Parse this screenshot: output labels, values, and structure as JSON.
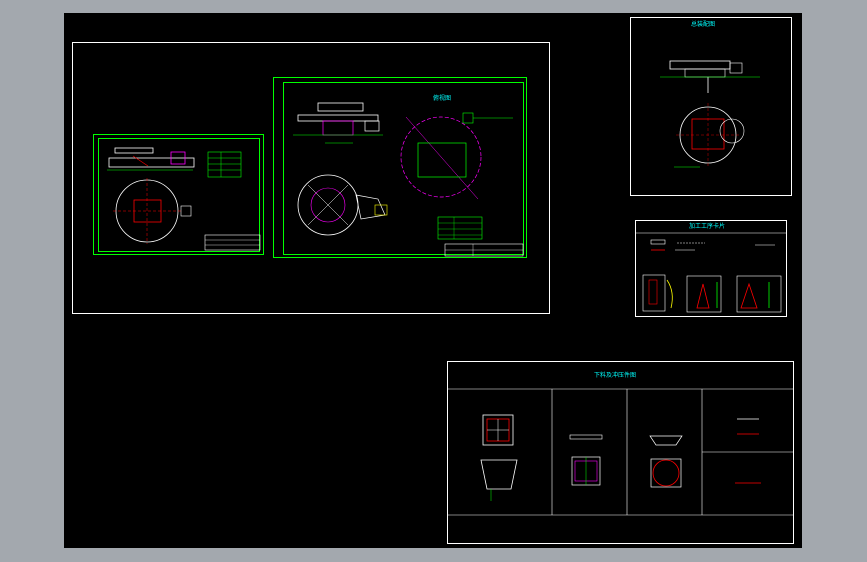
{
  "window": {
    "title": ""
  },
  "colors": {
    "background_outer": "#a3a8ae",
    "canvas": "#000000",
    "frame_white": "#ffffff",
    "line_green": "#00ff00",
    "line_red": "#ff0000",
    "line_cyan": "#00ffff",
    "line_magenta": "#ff00ff",
    "line_yellow": "#ffff00"
  },
  "sheets": {
    "top_right": {
      "title": "总装配图"
    },
    "mid_right": {
      "title": "加工工序卡片"
    },
    "bottom_right": {
      "title": "下料及冲压件图"
    },
    "center": {
      "label": "俯视图"
    }
  }
}
